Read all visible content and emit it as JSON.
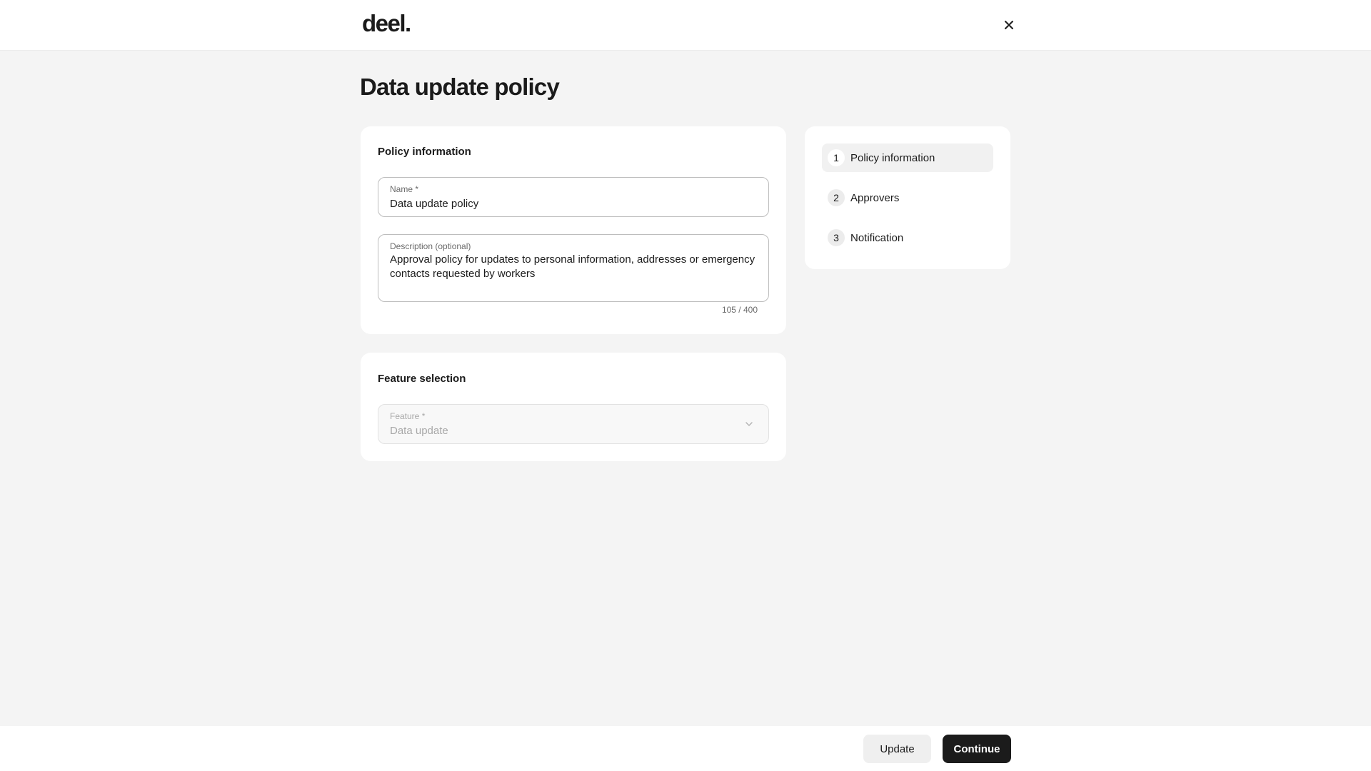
{
  "header": {
    "logo_text": "deel.",
    "close_icon": "close-icon"
  },
  "page": {
    "title": "Data update policy"
  },
  "policy_information": {
    "section_title": "Policy information",
    "name_field": {
      "label": "Name *",
      "value": "Data update policy"
    },
    "description_field": {
      "label": "Description (optional)",
      "value": "Approval policy for updates to personal information, addresses or emergency contacts requested by workers",
      "counter": "105 / 400"
    }
  },
  "feature_selection": {
    "section_title": "Feature selection",
    "feature_field": {
      "label": "Feature *",
      "value": "Data update",
      "icon": "chevron-down-icon",
      "disabled": true
    }
  },
  "steps": [
    {
      "number": "1",
      "label": "Policy information",
      "active": true
    },
    {
      "number": "2",
      "label": "Approvers",
      "active": false
    },
    {
      "number": "3",
      "label": "Notification",
      "active": false
    }
  ],
  "footer": {
    "update_label": "Update",
    "continue_label": "Continue"
  },
  "colors": {
    "background": "#f4f4f4",
    "primary_button": "#1b1b1b",
    "secondary_button": "#efefef"
  }
}
